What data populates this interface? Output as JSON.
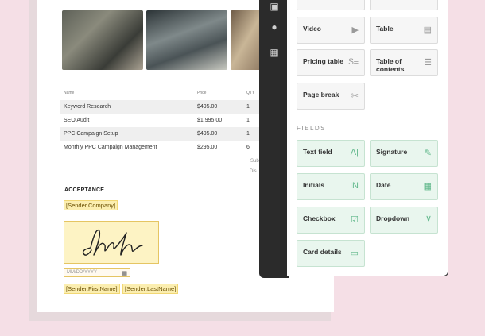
{
  "document": {
    "table": {
      "headers": [
        "Name",
        "Price",
        "QTY"
      ],
      "rows": [
        {
          "name": "Keyword Research",
          "price": "$495.00",
          "qty": "1"
        },
        {
          "name": "SEO Audit",
          "price": "$1,995.00",
          "qty": "1"
        },
        {
          "name": "PPC Campaign Setup",
          "price": "$495.00",
          "qty": "1"
        },
        {
          "name": "Monthly PPC Campaign Management",
          "price": "$295.00",
          "qty": "6"
        }
      ]
    },
    "subtotal_label": "Sub",
    "discount_label": "Dis",
    "acceptance_label": "ACCEPTANCE",
    "sender_company": "[Sender.Company]",
    "date_placeholder": "MM/DD/YYYY",
    "sender_firstname": "[Sender.FirstName]",
    "sender_lastname": "[Sender.LastName]"
  },
  "panel": {
    "blocks": [
      {
        "label": "Video",
        "icon": "video-icon"
      },
      {
        "label": "Table",
        "icon": "table-icon"
      },
      {
        "label": "Pricing table",
        "icon": "pricing-table-icon"
      },
      {
        "label": "Table of contents",
        "icon": "table-of-contents-icon"
      },
      {
        "label": "Page break",
        "icon": "page-break-icon"
      }
    ],
    "fields_title": "FIELDS",
    "fields": [
      {
        "label": "Text field",
        "icon": "text-field-icon"
      },
      {
        "label": "Signature",
        "icon": "signature-icon"
      },
      {
        "label": "Initials",
        "icon": "initials-icon"
      },
      {
        "label": "Date",
        "icon": "calendar-icon"
      },
      {
        "label": "Checkbox",
        "icon": "checkbox-icon"
      },
      {
        "label": "Dropdown",
        "icon": "dropdown-icon"
      },
      {
        "label": "Card details",
        "icon": "card-icon"
      }
    ]
  },
  "colors": {
    "background": "#f5dfe6",
    "toolbar": "#2b2b2b",
    "field_green": "#e9f6ee",
    "field_highlight": "#fbeeb0"
  }
}
